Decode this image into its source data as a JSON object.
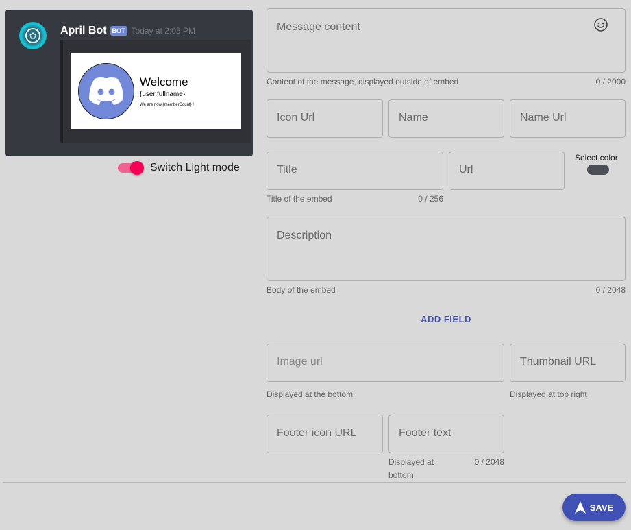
{
  "preview": {
    "bot_name": "April Bot",
    "badge": "BOT",
    "timestamp": "Today at 2:05 PM",
    "embed_image": {
      "title": "Welcome",
      "user": "{user.fullname}",
      "count_text": "We are now {memberCount} !"
    }
  },
  "theme_toggle": {
    "label": "Switch Light mode",
    "checked": true
  },
  "form": {
    "message_content": {
      "placeholder": "Message content",
      "helper": "Content of the message, displayed outside of embed",
      "counter": "0 / 2000"
    },
    "icon_url": {
      "placeholder": "Icon Url"
    },
    "name": {
      "placeholder": "Name"
    },
    "name_url": {
      "placeholder": "Name Url"
    },
    "title": {
      "placeholder": "Title",
      "helper": "Title of the embed",
      "counter": "0 / 256"
    },
    "url": {
      "placeholder": "Url"
    },
    "select_color": {
      "label": "Select color",
      "value": "#4b5057"
    },
    "description": {
      "placeholder": "Description",
      "helper": "Body of the embed",
      "counter": "0 / 2048"
    },
    "add_field_label": "ADD FIELD",
    "image_url": {
      "placeholder": "Image url",
      "helper": "Displayed at the bottom"
    },
    "thumbnail_url": {
      "placeholder": "Thumbnail URL",
      "helper": "Displayed at top right"
    },
    "footer_icon_url": {
      "placeholder": "Footer icon URL"
    },
    "footer_text": {
      "placeholder": "Footer text",
      "helper_line1": "Displayed at",
      "helper_line2": "bottom",
      "counter": "0 / 2048"
    }
  },
  "save_button": {
    "label": "SAVE"
  },
  "colors": {
    "accent": "#3f51b5",
    "toggle": "#f50057",
    "preview_bg": "#36393f",
    "discord_blurple": "#7289da"
  },
  "icons": {
    "emoji": "smiley-icon",
    "save": "send-arrow-icon",
    "avatar": "bot-avatar-icon",
    "discord": "discord-logo-icon"
  }
}
